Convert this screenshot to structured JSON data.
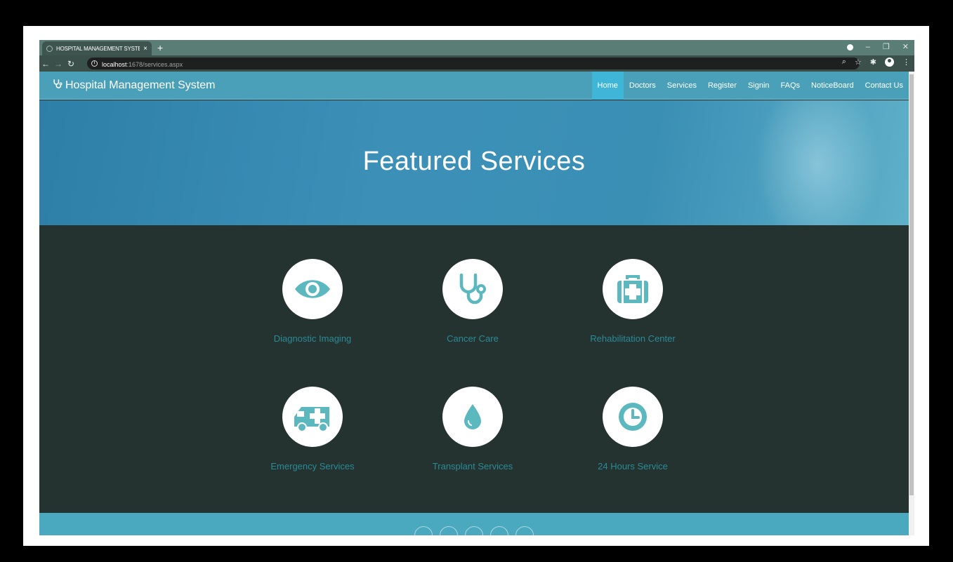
{
  "browser": {
    "tab_title": "HOSPITAL MANAGEMENT SYSTE",
    "url_host": "localhost",
    "url_rest": ":1678/services.aspx"
  },
  "site": {
    "brand": "Hospital Management System",
    "nav": [
      "Home",
      "Doctors",
      "Services",
      "Register",
      "Signin",
      "FAQs",
      "NoticeBoard",
      "Contact Us"
    ],
    "active_nav": "Home"
  },
  "hero": {
    "title": "Featured Services"
  },
  "services": [
    {
      "label": "Diagnostic Imaging",
      "icon": "eye-icon"
    },
    {
      "label": "Cancer Care",
      "icon": "stethoscope-icon"
    },
    {
      "label": "Rehabilitation Center",
      "icon": "medkit-icon"
    },
    {
      "label": "Emergency Services",
      "icon": "ambulance-icon"
    },
    {
      "label": "Transplant Services",
      "icon": "drop-icon"
    },
    {
      "label": "24 Hours Service",
      "icon": "clock-icon"
    }
  ],
  "colors": {
    "accent": "#4aa0b8",
    "icon": "#5bb8bf",
    "service_label": "#2a8a97",
    "section_bg": "#253330"
  }
}
